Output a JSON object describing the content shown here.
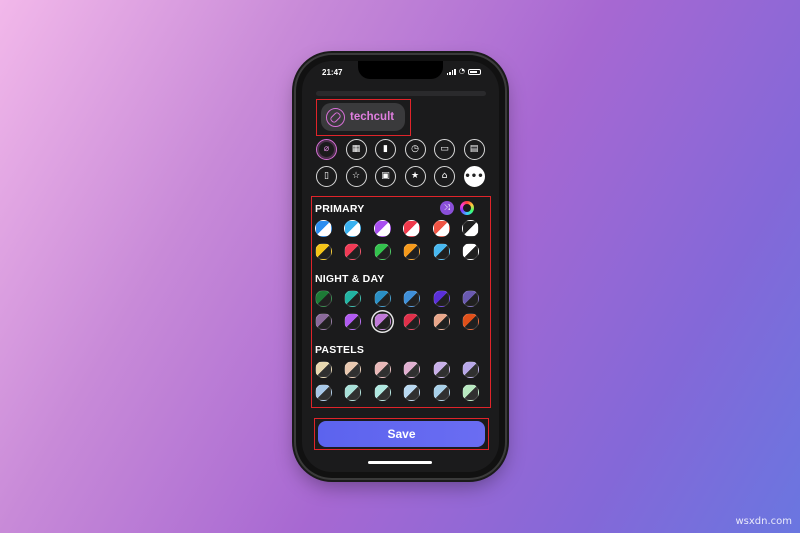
{
  "status_bar": {
    "time": "21:47"
  },
  "badge": {
    "label": "techcult",
    "icon": "tag-icon",
    "color": "#e07fe0"
  },
  "icon_rows": [
    [
      {
        "name": "tag-icon",
        "glyph": "⌀",
        "selected": true
      },
      {
        "name": "map-icon",
        "glyph": "▦"
      },
      {
        "name": "bookmark-icon",
        "glyph": "▮"
      },
      {
        "name": "clock-icon",
        "glyph": "◷"
      },
      {
        "name": "monitor-icon",
        "glyph": "▭"
      },
      {
        "name": "document-icon",
        "glyph": "▤"
      }
    ],
    [
      {
        "name": "bookmark-outline-icon",
        "glyph": "▯"
      },
      {
        "name": "star-icon",
        "glyph": "☆"
      },
      {
        "name": "calendar-icon",
        "glyph": "▣"
      },
      {
        "name": "starburst-icon",
        "glyph": "★"
      },
      {
        "name": "price-tag-icon",
        "glyph": "⌂"
      },
      {
        "name": "more-icon",
        "glyph": "•••",
        "more": true
      }
    ]
  ],
  "sections": {
    "primary": {
      "title": "PRIMARY",
      "swatches": [
        [
          "#2b8ef0",
          "#ffffff"
        ],
        [
          "#3ab2f0",
          "#ffffff"
        ],
        [
          "#a94ff0",
          "#ffffff"
        ],
        [
          "#f0394b",
          "#ffffff"
        ],
        [
          "#f05444",
          "#ffffff"
        ],
        [
          "#202020",
          "#ffffff"
        ],
        [
          "#f5c518",
          "#202020"
        ],
        [
          "#f03a55",
          "#202020"
        ],
        [
          "#33c24d",
          "#202020"
        ],
        [
          "#f59a1b",
          "#202020"
        ],
        [
          "#48b8f0",
          "#202020"
        ],
        [
          "#ffffff",
          "#202020"
        ]
      ]
    },
    "night_day": {
      "title": "NIGHT & DAY",
      "swatches": [
        [
          "#1d7a36",
          "#202020"
        ],
        [
          "#22b3a2",
          "#202020"
        ],
        [
          "#2a8fc4",
          "#202020"
        ],
        [
          "#3f8fd8",
          "#202020"
        ],
        [
          "#5a2fd8",
          "#202020"
        ],
        [
          "#6a5ab0",
          "#202020"
        ],
        [
          "#8a6a9a",
          "#202020"
        ],
        [
          "#b05af0",
          "#202020"
        ],
        [
          "#c07ad8",
          "#202020"
        ],
        [
          "#e0304a",
          "#202020"
        ],
        [
          "#e8a68a",
          "#202020"
        ],
        [
          "#e0501a",
          "#202020"
        ]
      ],
      "selected_index": 8
    },
    "pastels": {
      "title": "PASTELS",
      "swatches": [
        [
          "#e8d8b0",
          "#303030"
        ],
        [
          "#e8c8b0",
          "#303030"
        ],
        [
          "#e8b8b8",
          "#303030"
        ],
        [
          "#e0b0d0",
          "#303030"
        ],
        [
          "#c8b0e8",
          "#303030"
        ],
        [
          "#b8a8e8",
          "#303030"
        ],
        [
          "#a8c8e8",
          "#303030"
        ],
        [
          "#a8e0d8",
          "#303030"
        ],
        [
          "#b0e8e0",
          "#303030"
        ],
        [
          "#b8d8f0",
          "#303030"
        ],
        [
          "#a8d0e8",
          "#303030"
        ],
        [
          "#b8e8c0",
          "#303030"
        ]
      ]
    }
  },
  "save_button": {
    "label": "Save",
    "color": "#5c63ee"
  },
  "watermark": "wsxdn.com",
  "colors": {
    "highlight": "#e0242a",
    "screen_bg": "#1b1b1c"
  }
}
